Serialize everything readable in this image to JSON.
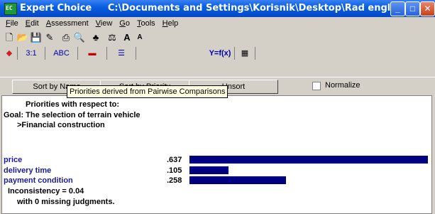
{
  "window": {
    "title": "Expert Choice     C:\\Documents and Settings\\Korisnik\\Desktop\\Rad engleski.ahp",
    "icon_text": "EC"
  },
  "menu": [
    "File",
    "Edit",
    "Assessment",
    "View",
    "Go",
    "Tools",
    "Help"
  ],
  "toolbar": {
    "buttons": [
      "new-icon",
      "open-icon",
      "save-icon",
      "edit-icon",
      "print-icon",
      "print-preview-icon",
      "hierarchy-icon",
      "compare-icon",
      "font-larger-icon",
      "font-smaller-icon"
    ]
  },
  "tabs": [
    "3:1",
    "ABC",
    "",
    "",
    "Y=f(x)",
    ""
  ],
  "sort": {
    "sort_by_name": "Sort by Name",
    "sort_by_priority": "Sort by Priority",
    "unsort": "Unsort",
    "normalize": "Normalize",
    "tooltip": "Priorities derived from Pairwise Comparisons"
  },
  "content": {
    "header": "Priorities with respect to:",
    "goal": "Goal: The selection of terrain vehicle",
    "node": ">Financial construction",
    "items": [
      {
        "label": "price",
        "value": ".637",
        "priority": 0.637
      },
      {
        "label": "delivery time",
        "value": ".105",
        "priority": 0.105
      },
      {
        "label": "payment condition",
        "value": ".258",
        "priority": 0.258
      }
    ],
    "inconsistency": "Inconsistency = 0.04",
    "missing": "with 0  missing judgments."
  },
  "colors": {
    "bar": "#000080",
    "label": "#1a1aa0"
  }
}
